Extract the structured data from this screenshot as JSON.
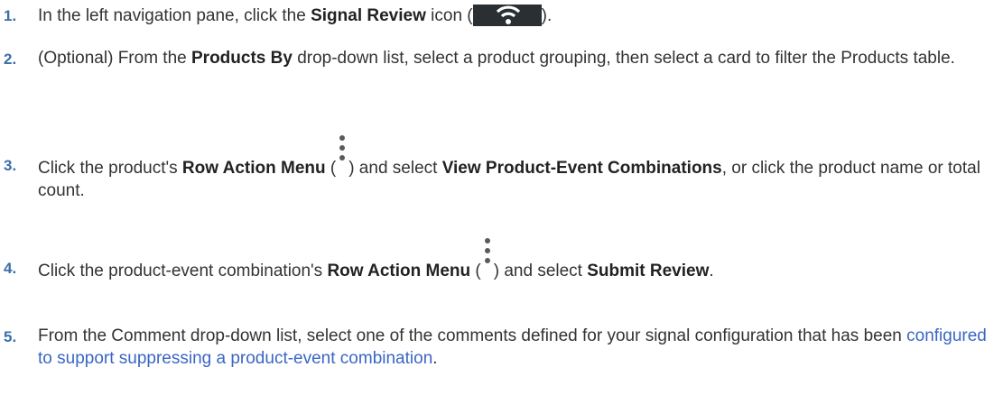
{
  "steps": [
    {
      "number": "1.",
      "parts": {
        "a": "In the left navigation pane, click the ",
        "b": "Signal Review",
        "c": " icon (",
        "d": ")."
      },
      "icon": "wifi-signal-icon"
    },
    {
      "number": "2.",
      "parts": {
        "a": "(Optional) From the ",
        "b": "Products By",
        "c": " drop-down list, select a product grouping, then select a card to filter the Products table."
      }
    },
    {
      "number": "3.",
      "parts": {
        "a": "Click the product's ",
        "b": "Row Action Menu",
        "c": " (",
        "d": ") and select ",
        "e": "View Product-Event Combinations",
        "f": ", or click the product name or total count."
      },
      "icon": "kebab-menu-icon"
    },
    {
      "number": "4.",
      "parts": {
        "a": "Click the product-event combination's ",
        "b": "Row Action Menu",
        "c": " (",
        "d": ") and select ",
        "e": "Submit Review",
        "f": "."
      },
      "icon": "kebab-menu-icon"
    },
    {
      "number": "5.",
      "parts": {
        "a": "From the Comment drop-down list, select one of the comments defined for your signal configuration that has been ",
        "link": "configured to support suppressing a product-event combination",
        "c": "."
      }
    }
  ],
  "colors": {
    "step_number": "#3b6fa8",
    "link": "#3a66c4",
    "icon_background": "#2a2f33"
  }
}
